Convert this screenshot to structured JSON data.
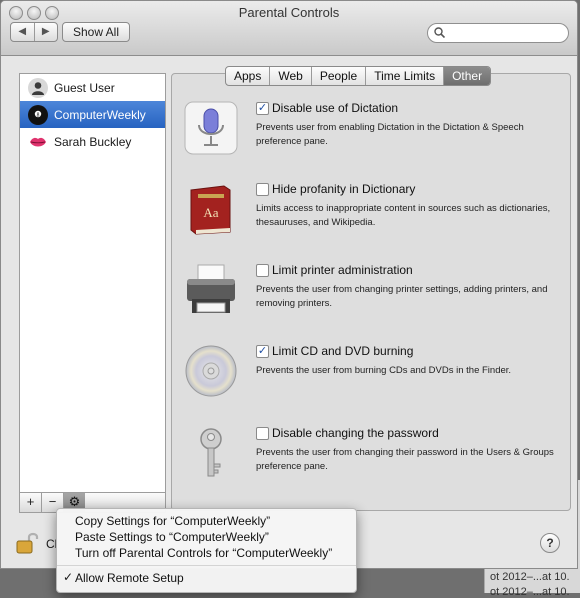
{
  "window": {
    "title": "Parental Controls"
  },
  "toolbar": {
    "show_all": "Show All",
    "back": "◀",
    "forward": "▶",
    "search_placeholder": ""
  },
  "users": [
    {
      "name": "Guest User",
      "selected": false,
      "avatar": "person-silhouette-icon"
    },
    {
      "name": "ComputerWeekly",
      "selected": true,
      "avatar": "eight-ball-icon"
    },
    {
      "name": "Sarah Buckley",
      "selected": false,
      "avatar": "lips-icon"
    }
  ],
  "sidebar_buttons": {
    "add": "+",
    "remove": "−",
    "action": "⚙"
  },
  "tabs": [
    {
      "label": "Apps",
      "active": false
    },
    {
      "label": "Web",
      "active": false
    },
    {
      "label": "People",
      "active": false
    },
    {
      "label": "Time Limits",
      "active": false
    },
    {
      "label": "Other",
      "active": true
    }
  ],
  "options": [
    {
      "label": "Disable use of Dictation",
      "checked": true,
      "icon": "microphone-icon",
      "description": "Prevents user from enabling Dictation in the Dictation & Speech preference pane."
    },
    {
      "label": "Hide profanity in Dictionary",
      "checked": false,
      "icon": "dictionary-book-icon",
      "description": "Limits access to inappropriate content in sources such as dictionaries, thesauruses, and Wikipedia."
    },
    {
      "label": "Limit printer administration",
      "checked": false,
      "icon": "printer-icon",
      "description": "Prevents the user from changing printer settings, adding printers, and removing printers."
    },
    {
      "label": "Limit CD and DVD burning",
      "checked": true,
      "icon": "disc-icon",
      "description": "Prevents the user from burning CDs and DVDs in the Finder."
    },
    {
      "label": "Disable changing the password",
      "checked": false,
      "icon": "key-icon",
      "description": "Prevents the user from changing their password in the Users & Groups preference pane."
    }
  ],
  "footer": {
    "lock_text": "Cl",
    "help": "?"
  },
  "menu": {
    "items": [
      "Copy Settings for “ComputerWeekly”",
      "Paste Settings to “ComputerWeekly”",
      "Turn off Parental Controls for “ComputerWeekly”"
    ],
    "checked_item": "Allow Remote Setup"
  },
  "background_text": [
    "ot 2012–...at 10.",
    "ot 2012–...at 10."
  ]
}
